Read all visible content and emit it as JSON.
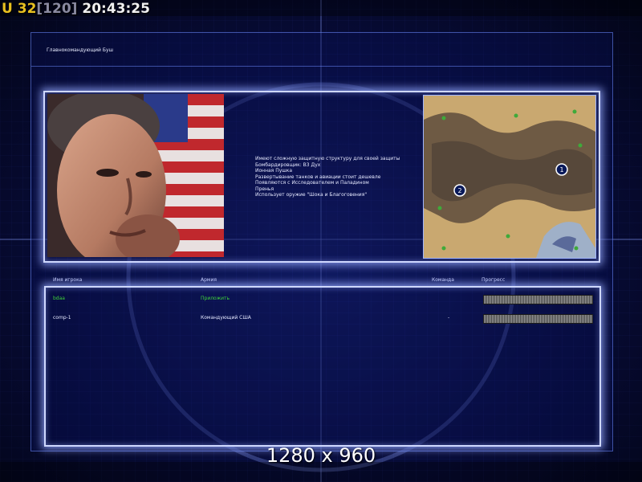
{
  "hud": {
    "prefix": "U",
    "count": "32",
    "bracket_value": "[120]",
    "clock": "20:43:25"
  },
  "title": "Главнокомандующий Буш",
  "description_lines": [
    "Имеют сложную защитную структуру для своей защиты",
    "Бомбардировщик: B3 Дух",
    "Ионная Пушка",
    "Развертывание танков и авиации стоит дешевле",
    "Появляются с Исследователем и Паладином",
    "Пренья",
    "Использует оружие \"Шока и Благоговения\""
  ],
  "table": {
    "headers": {
      "player": "Имя игрока",
      "army": "Армия",
      "team": "Команда",
      "progress": "Прогресс"
    },
    "rows": [
      {
        "player": "bdaa",
        "army": "Приложить",
        "team": "",
        "progress": 1.0,
        "color": "#3fd23a"
      },
      {
        "player": "comp-1",
        "army": "Командующий США",
        "team": "-",
        "progress": 1.0,
        "color": "#e4e8ff"
      }
    ]
  },
  "map": {
    "start_positions": [
      "1",
      "2"
    ]
  },
  "resolution_label": "1280 x 960",
  "colors": {
    "hud_yellow": "#e8c020",
    "frame_glow": "#cfd8ff",
    "local_player": "#3fd23a",
    "background": "#070b33"
  }
}
